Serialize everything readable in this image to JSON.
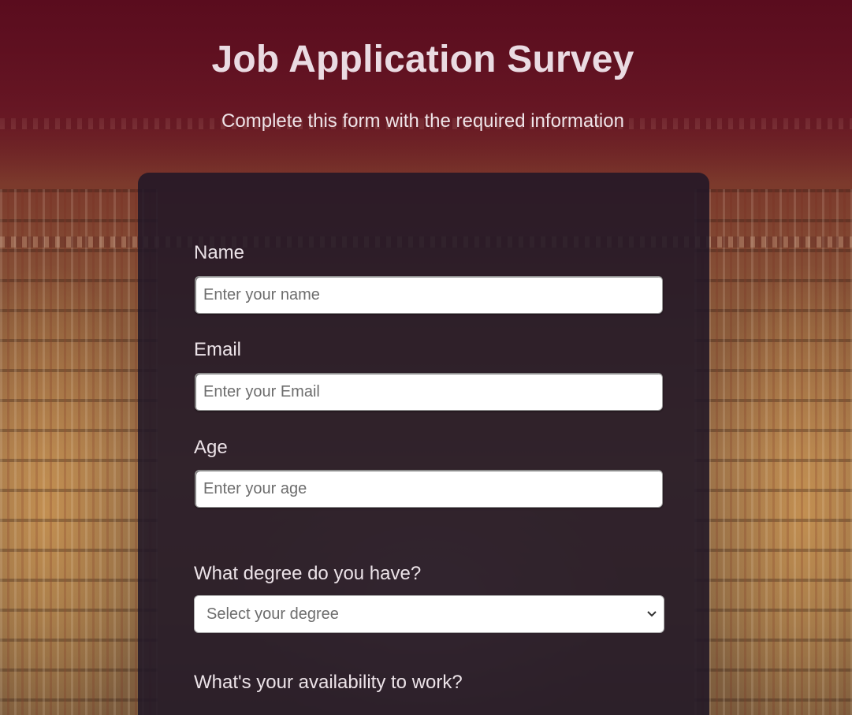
{
  "header": {
    "title": "Job Application Survey",
    "subtitle": "Complete this form with the required information"
  },
  "form": {
    "name": {
      "label": "Name",
      "placeholder": "Enter your name",
      "value": ""
    },
    "email": {
      "label": "Email",
      "placeholder": "Enter your Email",
      "value": ""
    },
    "age": {
      "label": "Age",
      "placeholder": "Enter your age",
      "value": ""
    },
    "degree": {
      "label": "What degree do you have?",
      "selected": "Select your degree"
    },
    "availability": {
      "label": "What's your availability to work?"
    }
  },
  "icons": {
    "select_arrow": "chevron-down-icon"
  },
  "colors": {
    "header_tint": "#5c0f20",
    "card_background": "#201626",
    "title_text": "#eadbe2"
  }
}
